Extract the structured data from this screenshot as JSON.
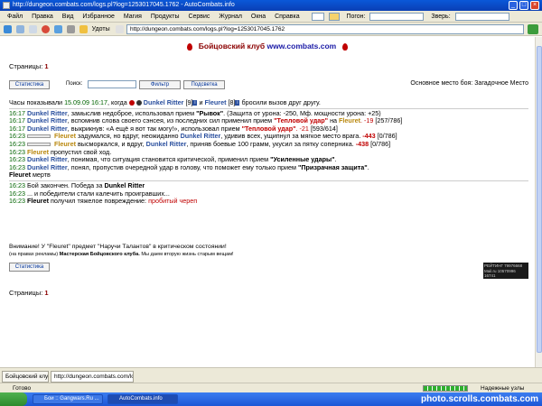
{
  "window": {
    "title": "http://dungeon.combats.com/logs.pl?log=1253017045.1762 - AutoCombats.info"
  },
  "menubar": {
    "items": [
      "Файл",
      "Правка",
      "Вид",
      "Избранное",
      "Магия",
      "Продукты",
      "Сервис",
      "Журнал",
      "Окна",
      "Справка"
    ],
    "group_label": "Погон:",
    "search_label": "Зверь:"
  },
  "navbar": {
    "favorites_label": "Удоты",
    "address": "http://dungeon.combats.com/logs.pl?log=1253017045.1762"
  },
  "page": {
    "title_prefix": "Бойцовский клуб",
    "title_url": "www.combats.com",
    "pages_label": "Страницы:",
    "pages_value": "1",
    "stats_button": "Статистика",
    "search_label": "Поиск:",
    "filter_button": "Фильтр",
    "highlight_button": "Подсветка",
    "location": "Основное место боя: Загадочное Место",
    "bottom_stats_button": "Статистика",
    "bottom_pages_label": "Страницы:",
    "bottom_pages_value": "1"
  },
  "log": {
    "intro_text": "Часы показывали",
    "intro_time": "15.09.09 16:17",
    "intro_when": ", когда",
    "p1": "Dunkel Ritter",
    "p1_level": "[9]",
    "and": "и",
    "p2": "Fleuret",
    "p2_level": "[8]",
    "intro_end": "бросили вызов друг другу.",
    "lines": [
      {
        "t": "16:17",
        "who": "Dunkel Ritter",
        "text": ", замыслив недоброе, использовал прием",
        "skill": "\"Рывок\"",
        "rest": ". (Защита от урона: -250, Мф. мощности урона: +25)"
      },
      {
        "t": "16:17",
        "who": "Dunkel Ritter",
        "text": ", вспомнив слова своего сэнсея, из последних сил применил прием",
        "skill": "\"Тепловой удар\"",
        "rest": "на",
        "target": "Fleuret",
        "dmg": ". -19",
        "hp": "[257/786]"
      },
      {
        "t": "16:17",
        "who": "Dunkel Ritter",
        "text": ", выкрикнув: «А ещё я вот так могу!», использовал прием",
        "skill": "\"Тепловой удар\"",
        "dmg": ". -21",
        "hp": "[593/614]"
      },
      {
        "t": "16:23",
        "who": "Fleuret",
        "text": "задумался, но вдруг, неожиданно",
        "who2": "Dunkel Ritter",
        "rest": ", удивив всех, ущипнул за мягкое место врага.",
        "dmg": "-443",
        "hp": "[0/786]"
      },
      {
        "t": "16:23",
        "who": "Fleuret",
        "text": "высморкался, и вдруг,",
        "who2": "Dunkel Ritter",
        "rest": ", приняв боевые 100 грамм, укусил за пятку соперника.",
        "dmg": "-438",
        "hp": "[0/786]"
      },
      {
        "t": "16:23",
        "who": "Fleuret",
        "text": "пропустил свой ход."
      },
      {
        "t": "16:23",
        "who": "Dunkel Ritter",
        "text": ", понимая, что ситуация становится критической, применил прием",
        "skill": "\"Усиленные удары\"",
        "rest": "."
      },
      {
        "t": "16:23",
        "who": "Dunkel Ritter",
        "text": ", понял, пропустив очередной удар в голову, что поможет ему только прием",
        "skill": "\"Призрачная защита\"",
        "rest": "."
      },
      {
        "t": "",
        "who": "Fleuret",
        "text": "мертв"
      }
    ],
    "end_lines": [
      {
        "t": "16:23",
        "text": "Бой закончен. Победа за",
        "who": "Dunkel Ritter"
      },
      {
        "t": "16:23",
        "text": "... и победители стали калечить проигравших..."
      },
      {
        "t": "16:23",
        "who": "Fleuret",
        "text": "получил тяжелое повреждение:",
        "injury": "пробитый череп"
      }
    ]
  },
  "footer_note": {
    "line1": "Внимание! У \"Fleuret\" предмет \"Наручи Талантов\" в критическом состоянии!",
    "line2_prefix": "(на правах рекламы)",
    "line2_bold": "Мастерская Бойцовского клуба.",
    "line2_rest": "Мы даем вторую жизнь старым вещам!"
  },
  "counter": {
    "lines": [
      "РЕЙТИНГ 79976668",
      "Mail.ru 10570996",
      "16741"
    ]
  },
  "tabs": [
    "Бойцовский клуб",
    "http://dungeon.combats.com/lo..."
  ],
  "status": {
    "text": "Готово",
    "zone": "Надежные узлы"
  },
  "taskbar": {
    "tasks": [
      "Бои :: Gangwars.Ru ...",
      "AutoCombats.info"
    ],
    "watermark": "photo.scrolls.combats.com"
  },
  "colors": {
    "accent": "#8b0000",
    "player_blue": "#2a4f9e",
    "player_orange": "#b8860b",
    "damage_red": "#c00000",
    "time_green": "#006400"
  }
}
